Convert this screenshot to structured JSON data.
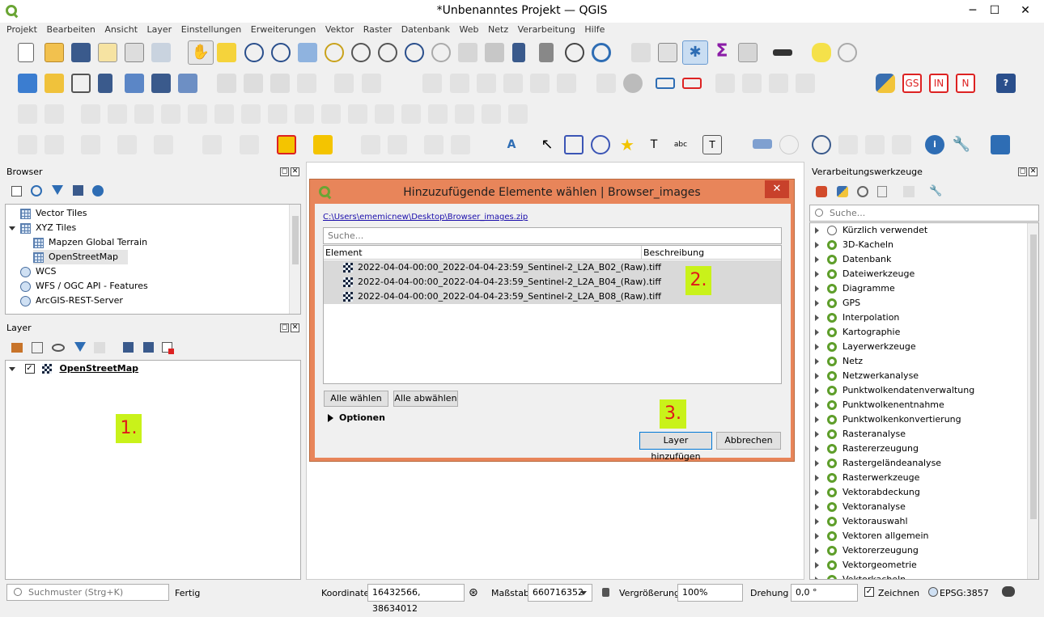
{
  "window": {
    "title": "*Unbenanntes Projekt — QGIS",
    "min": "─",
    "max": "☐",
    "close": "✕"
  },
  "menu": [
    "Projekt",
    "Bearbeiten",
    "Ansicht",
    "Layer",
    "Einstellungen",
    "Erweiterungen",
    "Vektor",
    "Raster",
    "Datenbank",
    "Web",
    "Netz",
    "Verarbeitung",
    "Hilfe"
  ],
  "toolbar": {
    "labels": {
      "gs": "GS",
      "in": "IN",
      "n": "N"
    }
  },
  "browser": {
    "title": "Browser",
    "items": [
      {
        "label": "Vector Tiles",
        "depth": 0,
        "icon": "grid-icon",
        "expander": ""
      },
      {
        "label": "XYZ Tiles",
        "depth": 0,
        "icon": "grid-icon",
        "expander": "open"
      },
      {
        "label": "Mapzen Global Terrain",
        "depth": 1,
        "icon": "grid-icon",
        "expander": ""
      },
      {
        "label": "OpenStreetMap",
        "depth": 1,
        "icon": "grid-icon",
        "expander": "",
        "selected": true
      },
      {
        "label": "WCS",
        "depth": 0,
        "icon": "globe-icon",
        "expander": ""
      },
      {
        "label": "WFS / OGC API - Features",
        "depth": 0,
        "icon": "globe-icon",
        "expander": ""
      },
      {
        "label": "ArcGIS-REST-Server",
        "depth": 0,
        "icon": "globe-icon",
        "expander": ""
      }
    ]
  },
  "layers": {
    "title": "Layer",
    "item": "OpenStreetMap"
  },
  "markers": {
    "one": "1.",
    "two": "2.",
    "three": "3."
  },
  "dialog": {
    "title": "Hinzuzufügende Elemente wählen | Browser_images",
    "path": "C:\\Users\\ememicnew\\Desktop\\Browser_images.zip",
    "search_placeholder": "Suche...",
    "col_element": "Element",
    "col_desc": "Beschreibung",
    "files": [
      "2022-04-04-00:00_2022-04-04-23:59_Sentinel-2_L2A_B02_(Raw).tiff",
      "2022-04-04-00:00_2022-04-04-23:59_Sentinel-2_L2A_B04_(Raw).tiff",
      "2022-04-04-00:00_2022-04-04-23:59_Sentinel-2_L2A_B08_(Raw).tiff"
    ],
    "select_all": "Alle wählen",
    "deselect_all": "Alle abwählen",
    "options": "Optionen",
    "add": "Layer hinzufügen",
    "cancel": "Abbrechen"
  },
  "processing": {
    "title": "Verarbeitungswerkzeuge",
    "search_placeholder": "Suche...",
    "items": [
      "Kürzlich verwendet",
      "3D-Kacheln",
      "Datenbank",
      "Dateiwerkzeuge",
      "Diagramme",
      "GPS",
      "Interpolation",
      "Kartographie",
      "Layerwerkzeuge",
      "Netz",
      "Netzwerkanalyse",
      "Punktwolkendatenverwaltung",
      "Punktwolkenentnahme",
      "Punktwolkenkonvertierung",
      "Rasteranalyse",
      "Rastererzeugung",
      "Rastergeländeanalyse",
      "Rasterwerkzeuge",
      "Vektorabdeckung",
      "Vektoranalyse",
      "Vektorauswahl",
      "Vektoren allgemein",
      "Vektorerzeugung",
      "Vektorgeometrie",
      "Vektorkacheln"
    ]
  },
  "status": {
    "search_placeholder": "Suchmuster (Strg+K)",
    "ready": "Fertig",
    "coord_label": "Koordinate",
    "coord_value": "16432566, 38634012",
    "scale_label": "Maßstab",
    "scale_value": "660716352",
    "magnifier_label": "Vergrößerung",
    "magnifier_value": "100%",
    "rotation_label": "Drehung",
    "rotation_value": "0,0 °",
    "render_label": "Zeichnen",
    "crs": "EPSG:3857"
  }
}
